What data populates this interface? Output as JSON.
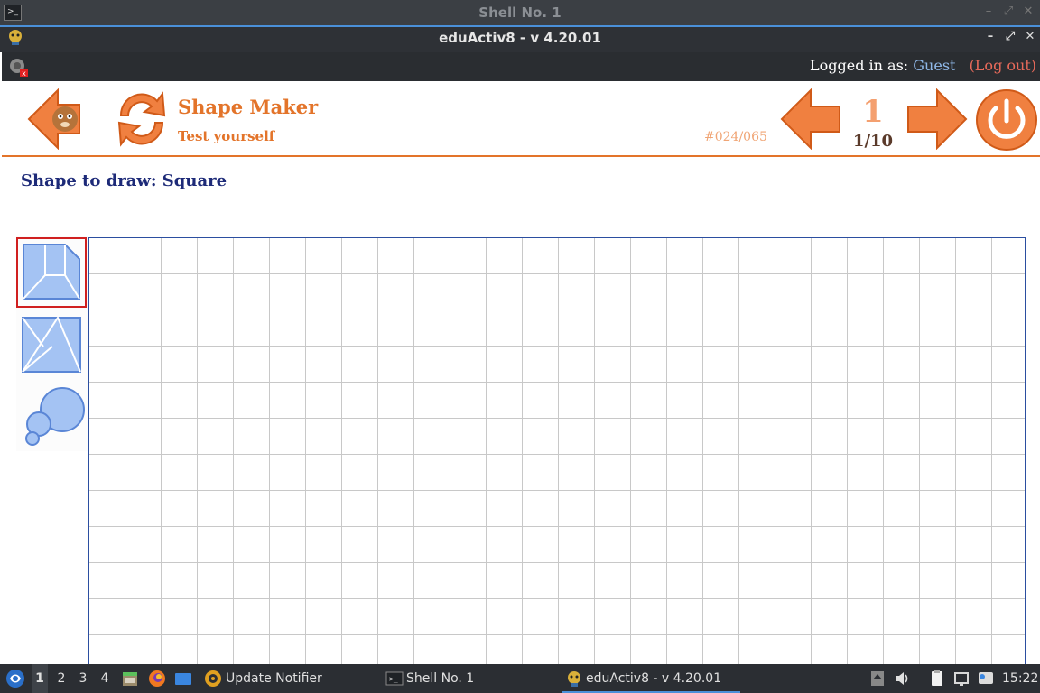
{
  "outer_window": {
    "title": "Shell No. 1"
  },
  "app_window": {
    "title": "eduActiv8 - v 4.20.01"
  },
  "login": {
    "prefix": "Logged in as:",
    "user": "Guest",
    "logout": "(Log out)"
  },
  "header": {
    "title": "Shape Maker",
    "subtitle": "Test yourself",
    "code": "#024/065",
    "page_number": "1",
    "page_count": "1/10"
  },
  "instruction": "Shape to draw: Square",
  "tools": [
    {
      "name": "quadrilateral-tool",
      "selected": true
    },
    {
      "name": "triangle-tool",
      "selected": false
    },
    {
      "name": "circle-tool",
      "selected": false
    }
  ],
  "colors": {
    "accent": "#e3742a",
    "instruction": "#1d2a78",
    "grid_border": "#2b4ea0",
    "drawn_line": "#b03030",
    "selection": "#d02020"
  },
  "taskbar": {
    "workspaces": [
      "1",
      "2",
      "3",
      "4"
    ],
    "tasks": [
      "Update Notifier",
      "Shell No. 1",
      "eduActiv8 - v 4.20.01"
    ],
    "clock": "15:22"
  }
}
